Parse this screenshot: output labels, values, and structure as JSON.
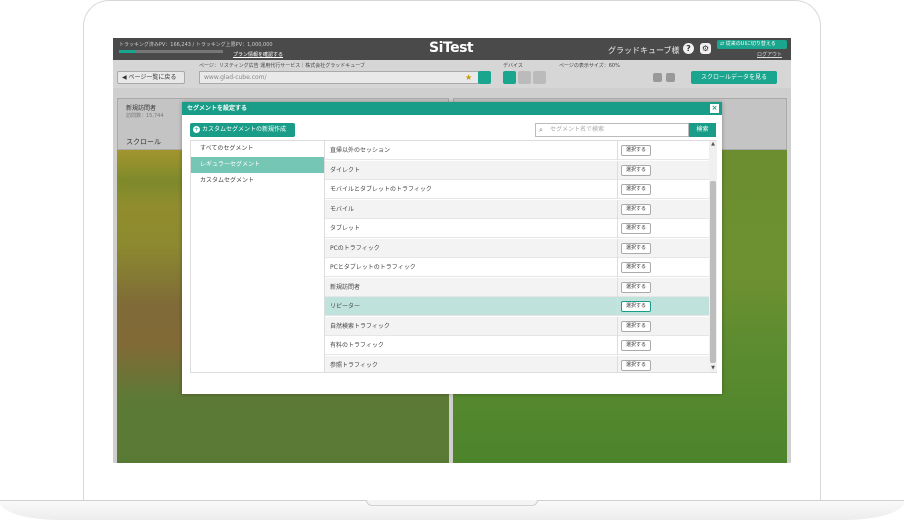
{
  "app": {
    "logo": "SiTest",
    "tracking": "トラッキング済みPV：166,243 / トラッキング上限PV：1,000,000",
    "tracking_fraction": 0.166,
    "plan_link": "プラン情報を確認する",
    "user": "グラッドキューブ様",
    "old_ui_btn": "⇄ 従来のUIに切り替える",
    "logout": "ログアウト"
  },
  "toolbar": {
    "back": "ページ一覧に戻る",
    "page_label": "ページ：リスティング広告 運用代行サービス｜株式会社グラッドキューブ",
    "url": "www.glad-cube.com/",
    "device_label": "デバイス",
    "size_label": "ページの表示サイズ：60%",
    "scroll_btn": "スクロールデータを見る"
  },
  "modal": {
    "title": "セグメントを設定する",
    "close": "×",
    "new_btn": "カスタムセグメントの新規作成",
    "search_placeholder": "セグメント名で検索",
    "search_btn": "検索",
    "categories": [
      {
        "label": "すべてのセグメント",
        "selected": false
      },
      {
        "label": "レギュラーセグメント",
        "selected": true
      },
      {
        "label": "カスタムセグメント",
        "selected": false
      }
    ],
    "select_label": "選択する",
    "segments": [
      "直帰以外のセッション",
      "ダイレクト",
      "モバイルとタブレットのトラフィック",
      "モバイル",
      "タブレット",
      "PCのトラフィック",
      "PCとタブレットのトラフィック",
      "新規訪問者",
      "リピーター",
      "自然検索トラフィック",
      "有料のトラフィック",
      "参照トラフィック"
    ],
    "highlighted_index": 8
  },
  "background": {
    "panel_title": "新規訪問者",
    "panel_sub": "訪問数：15,744",
    "scroll_tab": "スクロール"
  }
}
